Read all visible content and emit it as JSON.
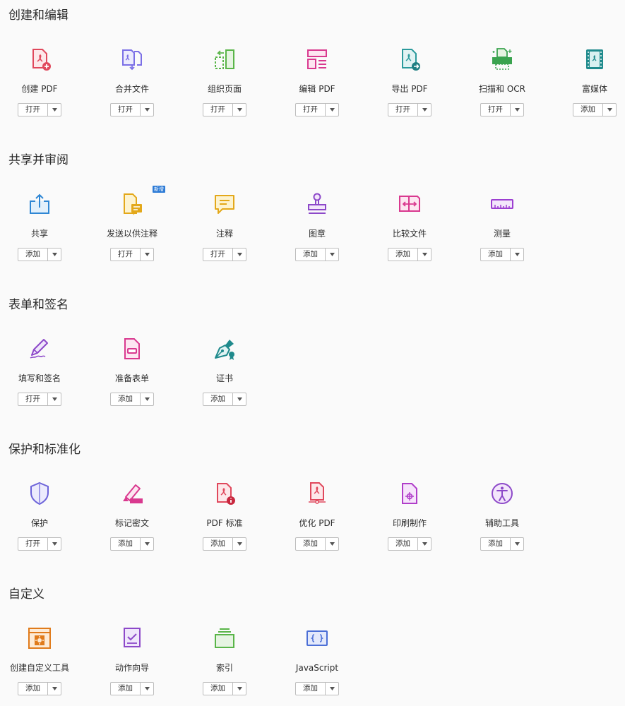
{
  "sections": [
    {
      "title": "创建和编辑",
      "tools": [
        {
          "label": "创建 PDF",
          "action": "打开",
          "icon": "create-pdf-icon"
        },
        {
          "label": "合并文件",
          "action": "打开",
          "icon": "combine-files-icon"
        },
        {
          "label": "组织页面",
          "action": "打开",
          "icon": "organize-pages-icon"
        },
        {
          "label": "编辑 PDF",
          "action": "打开",
          "icon": "edit-pdf-icon"
        },
        {
          "label": "导出 PDF",
          "action": "打开",
          "icon": "export-pdf-icon"
        },
        {
          "label": "扫描和 OCR",
          "action": "打开",
          "icon": "scan-ocr-icon"
        },
        {
          "label": "富媒体",
          "action": "添加",
          "icon": "rich-media-icon"
        }
      ]
    },
    {
      "title": "共享并审阅",
      "tools": [
        {
          "label": "共享",
          "action": "添加",
          "icon": "share-icon"
        },
        {
          "label": "发送以供注释",
          "action": "打开",
          "icon": "send-for-comments-icon",
          "badge": "新增"
        },
        {
          "label": "注释",
          "action": "打开",
          "icon": "comment-icon"
        },
        {
          "label": "图章",
          "action": "添加",
          "icon": "stamp-icon"
        },
        {
          "label": "比较文件",
          "action": "添加",
          "icon": "compare-files-icon"
        },
        {
          "label": "测量",
          "action": "添加",
          "icon": "measure-icon"
        }
      ]
    },
    {
      "title": "表单和签名",
      "tools": [
        {
          "label": "填写和签名",
          "action": "打开",
          "icon": "fill-sign-icon"
        },
        {
          "label": "准备表单",
          "action": "添加",
          "icon": "prepare-form-icon"
        },
        {
          "label": "证书",
          "action": "添加",
          "icon": "certificates-icon"
        }
      ]
    },
    {
      "title": "保护和标准化",
      "tools": [
        {
          "label": "保护",
          "action": "打开",
          "icon": "protect-icon"
        },
        {
          "label": "标记密文",
          "action": "添加",
          "icon": "redact-icon"
        },
        {
          "label": "PDF 标准",
          "action": "添加",
          "icon": "pdf-standards-icon"
        },
        {
          "label": "优化 PDF",
          "action": "添加",
          "icon": "optimize-pdf-icon"
        },
        {
          "label": "印刷制作",
          "action": "添加",
          "icon": "print-production-icon"
        },
        {
          "label": "辅助工具",
          "action": "添加",
          "icon": "accessibility-icon"
        }
      ]
    },
    {
      "title": "自定义",
      "tools": [
        {
          "label": "创建自定义工具",
          "action": "添加",
          "icon": "custom-tool-icon"
        },
        {
          "label": "动作向导",
          "action": "添加",
          "icon": "action-wizard-icon"
        },
        {
          "label": "索引",
          "action": "添加",
          "icon": "index-icon"
        },
        {
          "label": "JavaScript",
          "action": "添加",
          "icon": "javascript-icon"
        }
      ]
    }
  ]
}
